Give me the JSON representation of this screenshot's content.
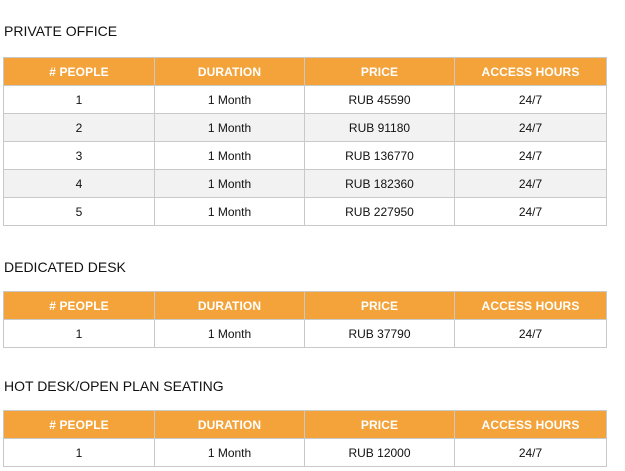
{
  "headers": [
    "# PEOPLE",
    "DURATION",
    "PRICE",
    "ACCESS HOURS"
  ],
  "sections": [
    {
      "title": "PRIVATE OFFICE",
      "rows": [
        [
          "1",
          "1 Month",
          "RUB 45590",
          "24/7"
        ],
        [
          "2",
          "1 Month",
          "RUB 91180",
          "24/7"
        ],
        [
          "3",
          "1 Month",
          "RUB 136770",
          "24/7"
        ],
        [
          "4",
          "1 Month",
          "RUB 182360",
          "24/7"
        ],
        [
          "5",
          "1 Month",
          "RUB 227950",
          "24/7"
        ]
      ]
    },
    {
      "title": "DEDICATED DESK",
      "rows": [
        [
          "1",
          "1 Month",
          "RUB 37790",
          "24/7"
        ]
      ]
    },
    {
      "title": "HOT DESK/OPEN PLAN SEATING",
      "rows": [
        [
          "1",
          "1 Month",
          "RUB 12000",
          "24/7"
        ]
      ]
    }
  ],
  "colors": {
    "header_bg": "#f3a33a",
    "header_text": "#ffffff",
    "alt_row_bg": "#f2f2f2",
    "border": "#c9c9c9"
  }
}
